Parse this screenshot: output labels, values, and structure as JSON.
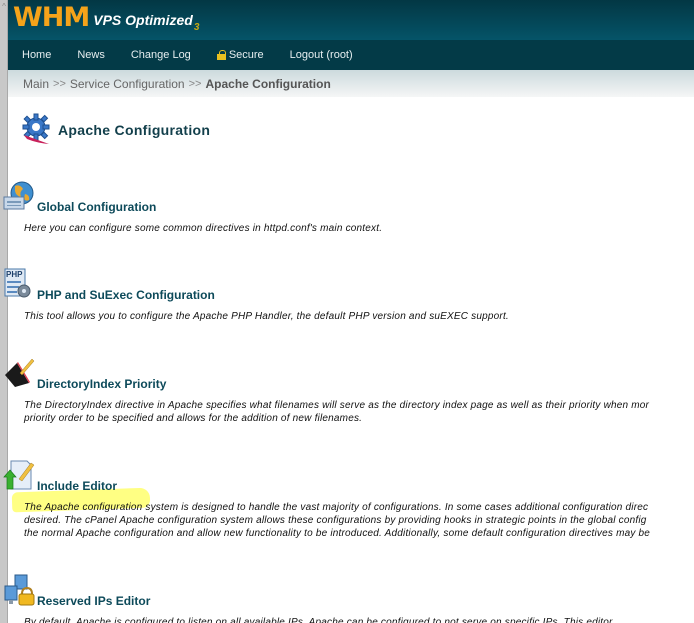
{
  "header": {
    "logo_main": "WHM",
    "logo_sub": "VPS Optimized",
    "logo_version": "3"
  },
  "nav": {
    "items": [
      {
        "label": "Home",
        "icon": null
      },
      {
        "label": "News",
        "icon": null
      },
      {
        "label": "Change Log",
        "icon": null
      },
      {
        "label": "Secure",
        "icon": "lock-icon"
      },
      {
        "label": "Logout (root)",
        "icon": null
      }
    ]
  },
  "breadcrumb": {
    "items": [
      "Main",
      "Service Configuration",
      "Apache Configuration"
    ],
    "separator": ">>"
  },
  "page": {
    "title": "Apache Configuration",
    "title_icon": "apache-gear-icon"
  },
  "items": [
    {
      "title": "Global Configuration",
      "icon": "globe-config-icon",
      "desc": [
        "Here you can configure some common directives in httpd.conf's main context."
      ]
    },
    {
      "title": "PHP and SuExec Configuration",
      "icon": "php-config-icon",
      "desc": [
        "This tool allows you to configure the Apache PHP Handler, the default PHP version and suEXEC support."
      ]
    },
    {
      "title": "DirectoryIndex Priority",
      "icon": "book-pencil-icon",
      "desc": [
        "The DirectoryIndex directive in Apache specifies what filenames will serve as the directory index page as well as their priority when mor",
        "priority order to be specified and allows for the addition of new filenames."
      ]
    },
    {
      "title": "Include Editor",
      "icon": "include-editor-icon",
      "desc": [
        "The Apache configuration system is designed to handle the vast majority of configurations. In some cases additional configuration direc",
        "desired. The cPanel Apache configuration system allows these configurations by providing hooks in strategic points in the global config",
        "the normal Apache configuration and allow new functionality to be introduced. Additionally, some default configuration directives may be"
      ]
    },
    {
      "title": "Reserved IPs Editor",
      "icon": "reserved-ips-icon",
      "desc": [
        "By default, Apache is configured to listen on all available IPs. Apache can be configured to not serve on specific IPs. This editor"
      ]
    }
  ],
  "colors": {
    "header_bg": "#044a5c",
    "nav_bg": "#033a47",
    "logo_orange": "#f5a31a",
    "title_color": "#123f4b",
    "link_color": "#0d4a5a",
    "highlight": "#ffff5a"
  }
}
